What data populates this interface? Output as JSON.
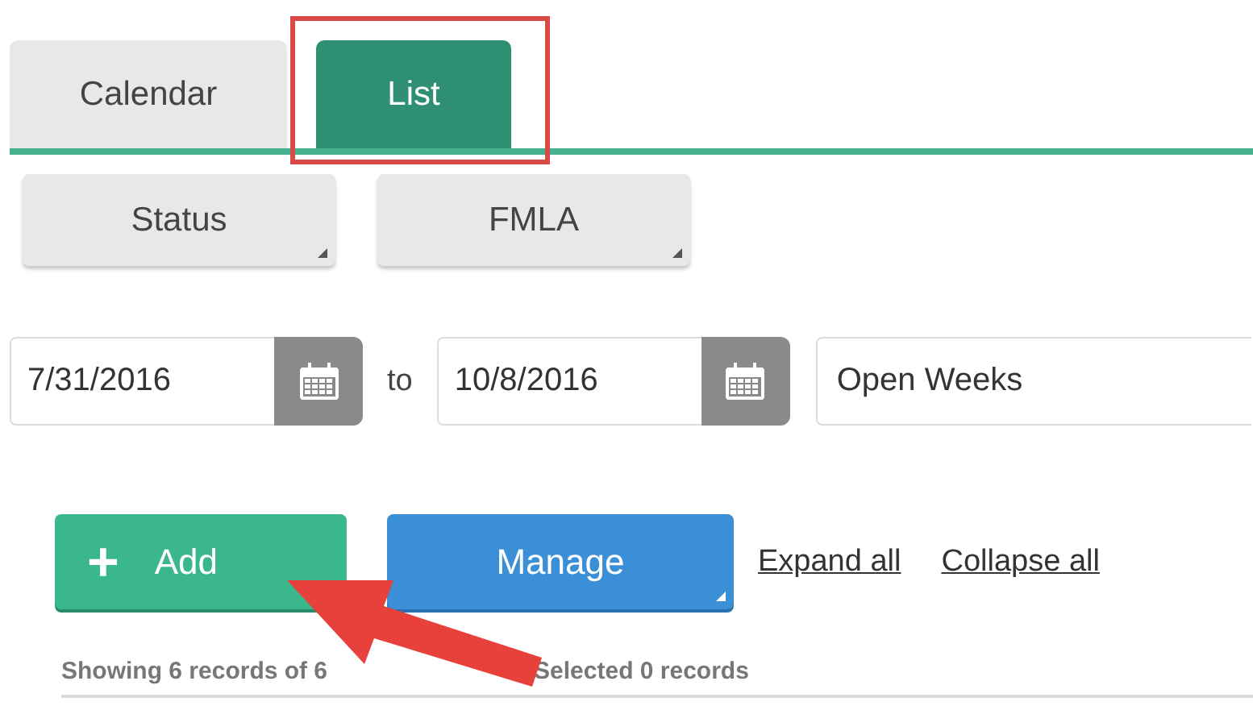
{
  "tabs": [
    {
      "label": "Calendar",
      "selected": false
    },
    {
      "label": "List",
      "selected": true
    }
  ],
  "filters": [
    {
      "label": "Status"
    },
    {
      "label": "FMLA"
    }
  ],
  "date_range": {
    "from": "7/31/2016",
    "separator": "to",
    "to": "10/8/2016"
  },
  "period": {
    "value": "Open Weeks"
  },
  "actions": [
    {
      "kind": "add",
      "label": "Add",
      "icon": "+"
    },
    {
      "kind": "menu",
      "label": "Manage"
    }
  ],
  "links": [
    "Expand all",
    "Collapse all"
  ],
  "status": {
    "showing": "Showing 6 records of 6",
    "selected": "Selected 0 records"
  }
}
